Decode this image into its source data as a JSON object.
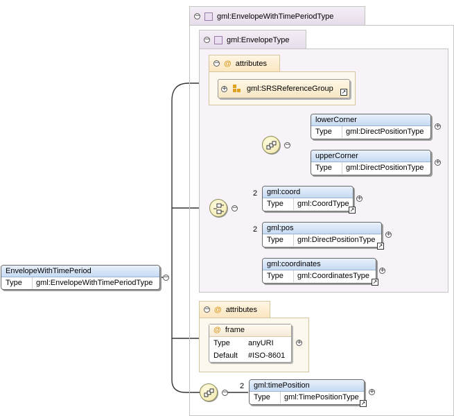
{
  "root_element": {
    "name": "EnvelopeWithTimePeriod",
    "type_label": "Type",
    "type": "gml:EnvelopeWithTimePeriodType"
  },
  "outer_type": {
    "name": "gml:EnvelopeWithTimePeriodType"
  },
  "inner_type": {
    "name": "gml:EnvelopeType"
  },
  "attributes_label": "attributes",
  "attributes_label_2": "attributes",
  "attr_group": {
    "name": "gml:SRSReferenceGroup"
  },
  "lower_corner": {
    "name": "lowerCorner",
    "type_label": "Type",
    "type": "gml:DirectPositionType"
  },
  "upper_corner": {
    "name": "upperCorner",
    "type_label": "Type",
    "type": "gml:DirectPositionType"
  },
  "coord": {
    "occurs": "2",
    "name": "gml:coord",
    "type_label": "Type",
    "type": "gml:CoordType"
  },
  "pos": {
    "occurs": "2",
    "name": "gml:pos",
    "type_label": "Type",
    "type": "gml:DirectPositionType"
  },
  "coordinates": {
    "name": "gml:coordinates",
    "type_label": "Type",
    "type": "gml:CoordinatesType"
  },
  "frame_attr": {
    "name": "frame",
    "type_label": "Type",
    "type": "anyURI",
    "default_label": "Default",
    "default": "#ISO-8601"
  },
  "time_position": {
    "occurs": "2",
    "name": "gml:timePosition",
    "type_label": "Type",
    "type": "gml:TimePositionType"
  }
}
